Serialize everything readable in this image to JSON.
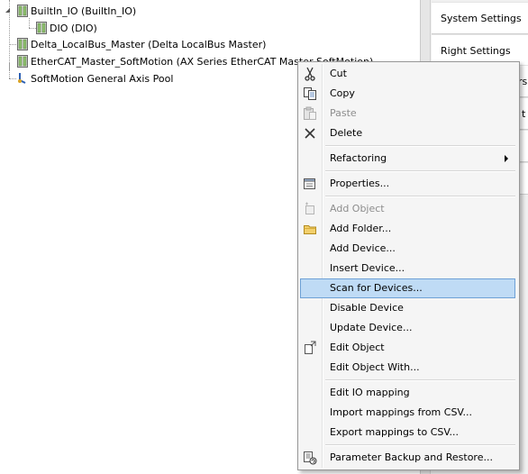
{
  "tree": {
    "nodes": [
      {
        "label": "BuiltIn_IO (BuiltIn_IO)"
      },
      {
        "label": "DIO (DIO)"
      },
      {
        "label": "Delta_LocalBus_Master (Delta LocalBus Master)"
      },
      {
        "label": "EtherCAT_Master_SoftMotion (AX Series EtherCAT Master SoftMotion)"
      },
      {
        "label": "SoftMotion General Axis Pool"
      }
    ]
  },
  "right_panel": {
    "items": [
      {
        "label": "System Settings"
      },
      {
        "label": "Right Settings"
      }
    ],
    "partial_labels": [
      "rs",
      "t"
    ]
  },
  "context_menu": {
    "items": [
      {
        "label": "Cut",
        "icon": "cut-icon",
        "enabled": true
      },
      {
        "label": "Copy",
        "icon": "copy-icon",
        "enabled": true
      },
      {
        "label": "Paste",
        "icon": "paste-icon",
        "enabled": false
      },
      {
        "label": "Delete",
        "icon": "delete-icon",
        "enabled": true
      },
      {
        "label": "Refactoring",
        "submenu": true,
        "enabled": true
      },
      {
        "label": "Properties...",
        "icon": "properties-icon",
        "enabled": true
      },
      {
        "label": "Add Object",
        "icon": "add-object-icon",
        "enabled": false
      },
      {
        "label": "Add Folder...",
        "icon": "folder-icon",
        "enabled": true
      },
      {
        "label": "Add Device...",
        "enabled": true
      },
      {
        "label": "Insert Device...",
        "enabled": true
      },
      {
        "label": "Scan for Devices...",
        "enabled": true,
        "highlighted": true
      },
      {
        "label": "Disable Device",
        "enabled": true
      },
      {
        "label": "Update Device...",
        "enabled": true
      },
      {
        "label": "Edit Object",
        "icon": "edit-object-icon",
        "enabled": true
      },
      {
        "label": "Edit Object With...",
        "enabled": true
      },
      {
        "label": "Edit IO mapping",
        "enabled": true
      },
      {
        "label": "Import mappings from CSV...",
        "enabled": true
      },
      {
        "label": "Export mappings to CSV...",
        "enabled": true
      },
      {
        "label": "Parameter Backup and Restore...",
        "icon": "backup-restore-icon",
        "enabled": true
      }
    ]
  },
  "colors": {
    "highlight_fill": "#bfdbf5",
    "highlight_border": "#6ea1d6",
    "menu_bg": "#f5f5f5",
    "disabled_text": "#8d8d8d",
    "accent_blue": "#3c84cf"
  }
}
